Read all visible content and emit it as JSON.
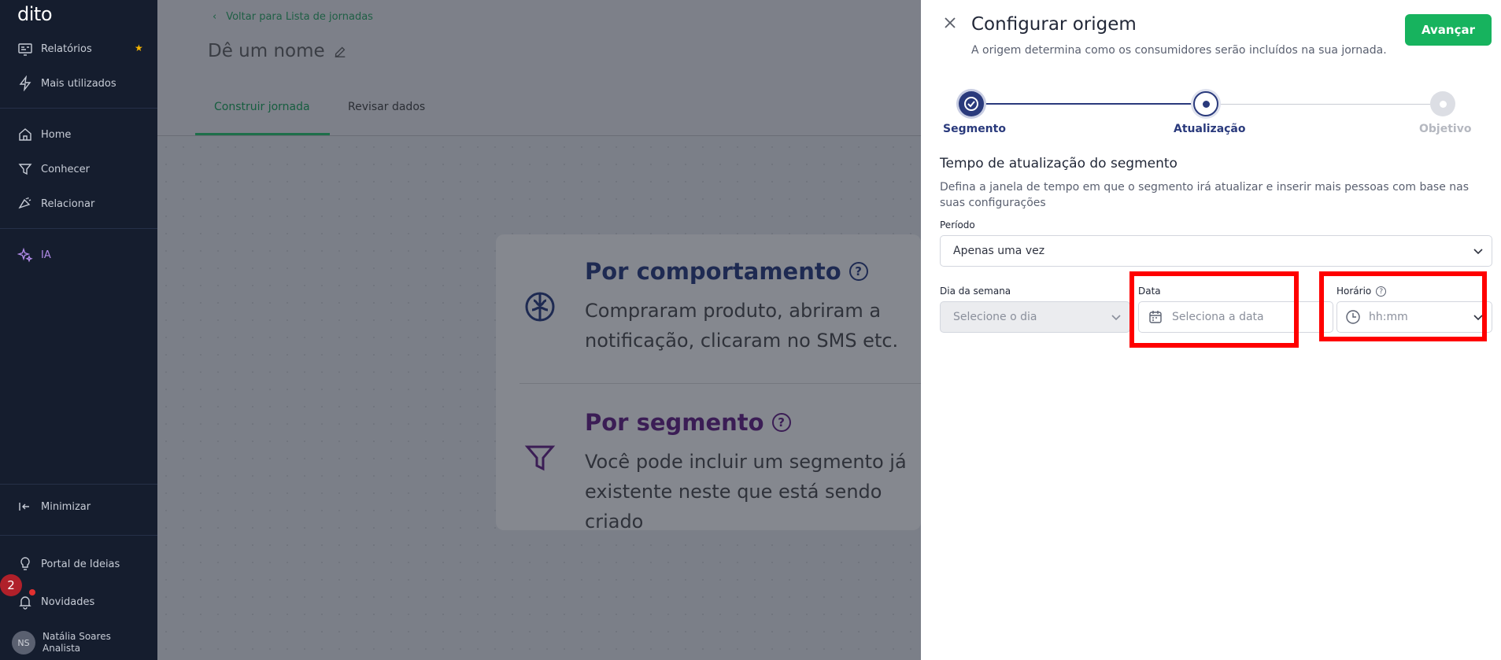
{
  "sidebar": {
    "logo": "dito",
    "items": [
      {
        "label": "Relatórios",
        "icon": "reports-icon"
      },
      {
        "label": "Mais utilizados",
        "icon": "lightning-icon"
      },
      {
        "label": "Home",
        "icon": "home-icon"
      },
      {
        "label": "Conhecer",
        "icon": "filter-icon"
      },
      {
        "label": "Relacionar",
        "icon": "megaphone-icon"
      },
      {
        "label": "IA",
        "icon": "sparkles-icon"
      },
      {
        "label": "Minimizar",
        "icon": "collapse-icon"
      },
      {
        "label": "Portal de Ideias",
        "icon": "lightbulb-icon"
      },
      {
        "label": "Novidades",
        "icon": "bell-icon"
      }
    ],
    "notification_count": "2",
    "user": {
      "initials": "NS",
      "name": "Natália Soares",
      "role": "Analista"
    }
  },
  "main": {
    "back_link": "Voltar para Lista de jornadas",
    "page_name": "Dê um nome",
    "tabs": [
      {
        "label": "Construir jornada",
        "active": true
      },
      {
        "label": "Revisar dados",
        "active": false
      }
    ],
    "options": [
      {
        "title": "Por comportamento",
        "description": "Compraram produto, abriram a notificação, clicaram no SMS etc."
      },
      {
        "title": "Por segmento",
        "description": "Você pode incluir um segmento já existente neste que está sendo criado"
      }
    ]
  },
  "panel": {
    "title": "Configurar origem",
    "subtitle": "A origem determina como os consumidores serão incluídos na sua jornada.",
    "next_button": "Avançar",
    "steps": [
      {
        "label": "Segmento",
        "state": "done"
      },
      {
        "label": "Atualização",
        "state": "current"
      },
      {
        "label": "Objetivo",
        "state": "pending"
      }
    ],
    "section_title": "Tempo de atualização do segmento",
    "section_desc": "Defina a janela de tempo em que o segmento irá atualizar e inserir mais pessoas com base nas suas configurações",
    "period_label": "Período",
    "period_value": "Apenas uma vez",
    "weekday_label": "Dia da semana",
    "weekday_placeholder": "Selecione o dia",
    "date_label": "Data",
    "date_placeholder": "Seleciona a data",
    "time_label": "Horário",
    "time_placeholder": "hh:mm"
  },
  "colors": {
    "sidebar_bg": "#151d2e",
    "primary_green": "#17b35e",
    "step_blue": "#2a3a7c",
    "highlight_red": "#ff0000"
  }
}
